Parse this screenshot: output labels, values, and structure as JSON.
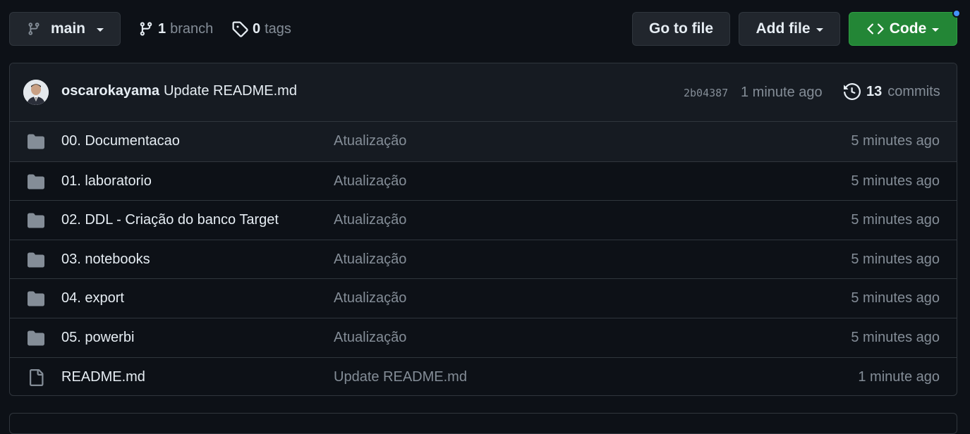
{
  "toolbar": {
    "branch_label": "main",
    "branch_count": "1",
    "branch_word": "branch",
    "tag_count": "0",
    "tag_word": "tags",
    "goto_label": "Go to file",
    "add_label": "Add file",
    "code_label": "Code"
  },
  "commit": {
    "author": "oscarokayama",
    "message": "Update README.md",
    "sha": "2b04387",
    "time": "1 minute ago",
    "commit_count": "13",
    "commit_word": "commits"
  },
  "files": [
    {
      "type": "folder",
      "name": "00. Documentacao",
      "message": "Atualização",
      "time": "5 minutes ago"
    },
    {
      "type": "folder",
      "name": "01. laboratorio",
      "message": "Atualização",
      "time": "5 minutes ago"
    },
    {
      "type": "folder",
      "name": "02. DDL - Criação do banco Target",
      "message": "Atualização",
      "time": "5 minutes ago"
    },
    {
      "type": "folder",
      "name": "03. notebooks",
      "message": "Atualização",
      "time": "5 minutes ago"
    },
    {
      "type": "folder",
      "name": "04. export",
      "message": "Atualização",
      "time": "5 minutes ago"
    },
    {
      "type": "folder",
      "name": "05. powerbi",
      "message": "Atualização",
      "time": "5 minutes ago"
    },
    {
      "type": "file",
      "name": "README.md",
      "message": "Update README.md",
      "time": "1 minute ago"
    }
  ],
  "colors": {
    "background": "#0d1117",
    "border": "#30363d",
    "code_button": "#238636",
    "muted_text": "#848d97",
    "notification": "#4493f8"
  },
  "icons": {
    "branch": "git-branch-icon",
    "tag": "tag-icon",
    "code": "code-icon",
    "history": "history-icon",
    "folder": "folder-icon",
    "file": "file-icon"
  }
}
